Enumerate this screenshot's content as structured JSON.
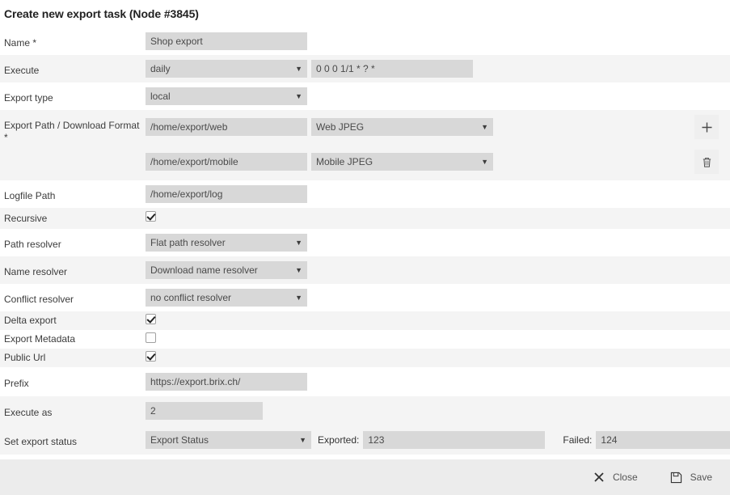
{
  "dialog": {
    "title": "Create new export task (Node #3845)"
  },
  "form": {
    "name": {
      "label": "Name *",
      "value": "Shop export"
    },
    "execute": {
      "label": "Execute",
      "interval": "daily",
      "cron": "0 0 0 1/1 * ? *"
    },
    "export_type": {
      "label": "Export type",
      "value": "local"
    },
    "export_path": {
      "label": "Export Path / Download Format *",
      "add_icon": "plus-icon",
      "delete_icon": "trash-icon",
      "rows": [
        {
          "path": "/home/export/web",
          "format": "Web JPEG"
        },
        {
          "path": "/home/export/mobile",
          "format": "Mobile JPEG"
        }
      ]
    },
    "logfile_path": {
      "label": "Logfile Path",
      "value": "/home/export/log"
    },
    "recursive": {
      "label": "Recursive",
      "checked": true
    },
    "path_resolver": {
      "label": "Path resolver",
      "value": "Flat path resolver"
    },
    "name_resolver": {
      "label": "Name resolver",
      "value": "Download name resolver"
    },
    "conflict_resolver": {
      "label": "Conflict resolver",
      "value": "no conflict resolver"
    },
    "delta_export": {
      "label": "Delta export",
      "checked": true
    },
    "export_metadata": {
      "label": "Export Metadata",
      "checked": false
    },
    "public_url": {
      "label": "Public Url",
      "checked": true
    },
    "prefix": {
      "label": "Prefix",
      "value": "https://export.brix.ch/"
    },
    "execute_as": {
      "label": "Execute as",
      "value": "2"
    },
    "export_status": {
      "label": "Set export status",
      "status": "Export Status",
      "exported_label": "Exported:",
      "exported_value": "123",
      "failed_label": "Failed:",
      "failed_value": "124"
    }
  },
  "footer": {
    "close_label": "Close",
    "close_icon": "close-x-icon",
    "save_label": "Save",
    "save_icon": "floppy-save-icon"
  },
  "colors": {
    "field_bg": "#d8d8d8",
    "row_alt_bg": "#f4f4f4",
    "footer_bg": "#ececec",
    "text": "#3c3c3c"
  }
}
